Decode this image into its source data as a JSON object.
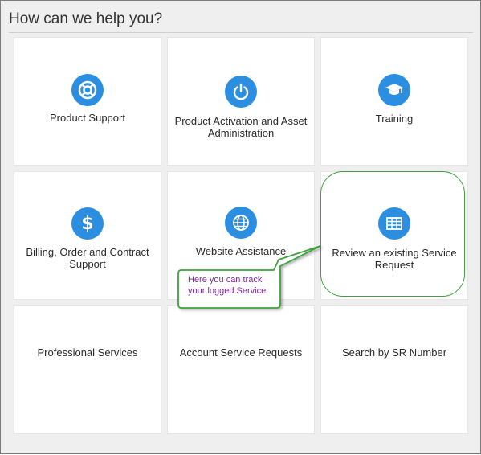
{
  "header": {
    "title": "How can we help you?"
  },
  "tiles": [
    {
      "label": "Product Support",
      "icon": "lifebuoy-icon"
    },
    {
      "label": "Product Activation and Asset Administration",
      "icon": "power-icon"
    },
    {
      "label": "Training",
      "icon": "graduation-cap-icon"
    },
    {
      "label": "Billing, Order and Contract Support",
      "icon": "dollar-icon"
    },
    {
      "label": "Website Assistance",
      "icon": "globe-icon"
    },
    {
      "label": "Review an existing Service Request",
      "icon": "table-icon"
    },
    {
      "label": "Professional Services"
    },
    {
      "label": "Account Service Requests"
    },
    {
      "label": "Search by SR Number"
    }
  ],
  "callout": {
    "text": "Here you can track your logged Service"
  },
  "colors": {
    "icon_blue": "#2b8ee0",
    "callout_green": "#3ca23c",
    "callout_text": "#7a2a9a",
    "background": "#efefef"
  }
}
